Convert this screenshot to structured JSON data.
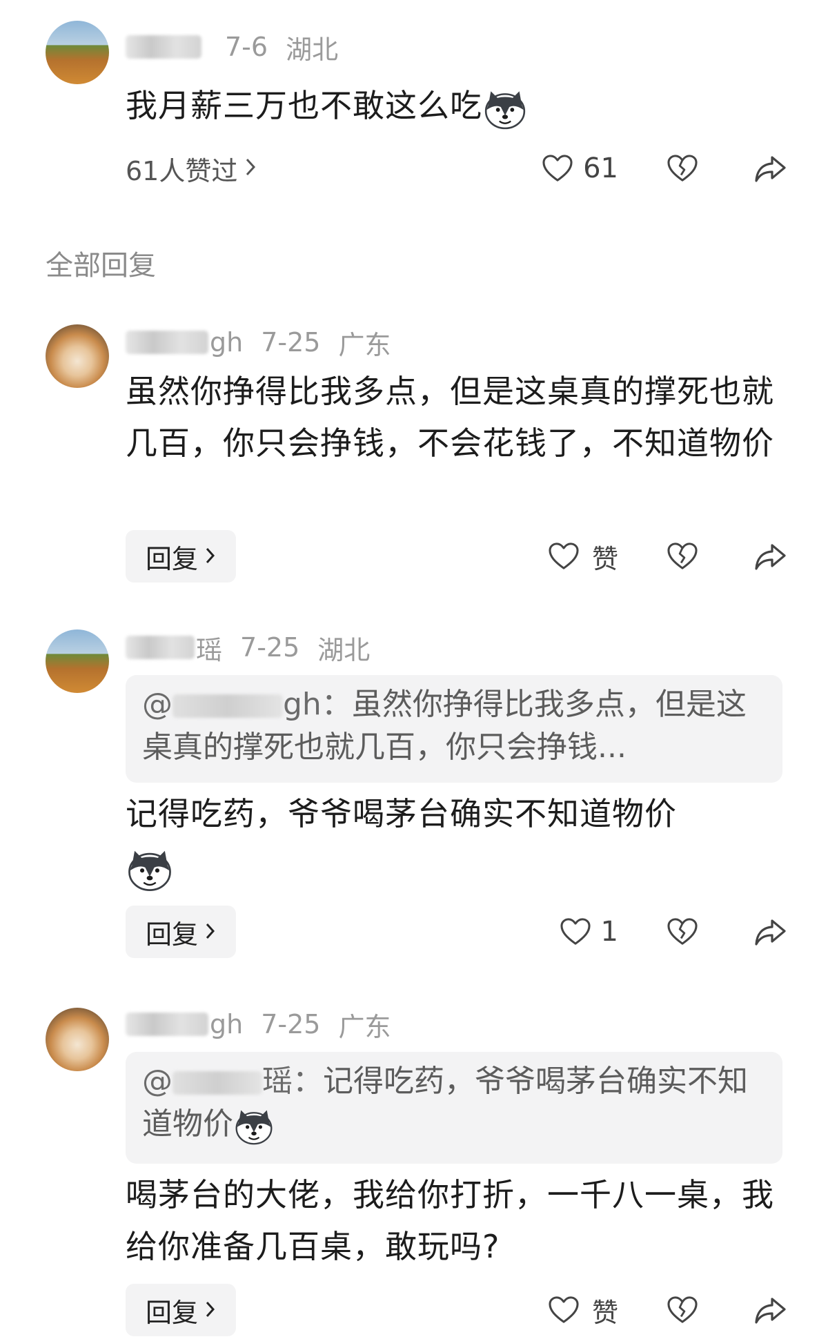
{
  "top_comment": {
    "date": "7-6",
    "region": "湖北",
    "text": "我月薪三万也不敢这么吃",
    "likes_summary": "61人赞过",
    "like_count": "61"
  },
  "section_title": "全部回复",
  "replies": [
    {
      "username_suffix": "gh",
      "date": "7-25",
      "region": "广东",
      "text": "虽然你挣得比我多点，但是这桌真的撑死也就几百，你只会挣钱，不会花钱了，不知道物价",
      "reply_label": "回复",
      "like_label": "赞"
    },
    {
      "username_suffix": "瑶",
      "date": "7-25",
      "region": "湖北",
      "quote_prefix": "@",
      "quote_name_suffix": "gh：",
      "quote_text": "虽然你挣得比我多点，但是这桌真的撑死也就几百，你只会挣钱...",
      "text": "记得吃药，爷爷喝茅台确实不知道物价",
      "reply_label": "回复",
      "like_count": "1"
    },
    {
      "username_suffix": "gh",
      "date": "7-25",
      "region": "广东",
      "quote_prefix": "@",
      "quote_name_suffix": "瑶：",
      "quote_text": "记得吃药，爷爷喝茅台确实不知道物价",
      "text": "喝茅台的大佬，我给你打折，一千八一桌，我给你准备几百桌，敢玩吗?",
      "reply_label": "回复",
      "like_label": "赞"
    }
  ],
  "colors": {
    "text": "#1c1c1c",
    "meta": "#9a9a9a",
    "bubble": "#f3f3f4"
  }
}
